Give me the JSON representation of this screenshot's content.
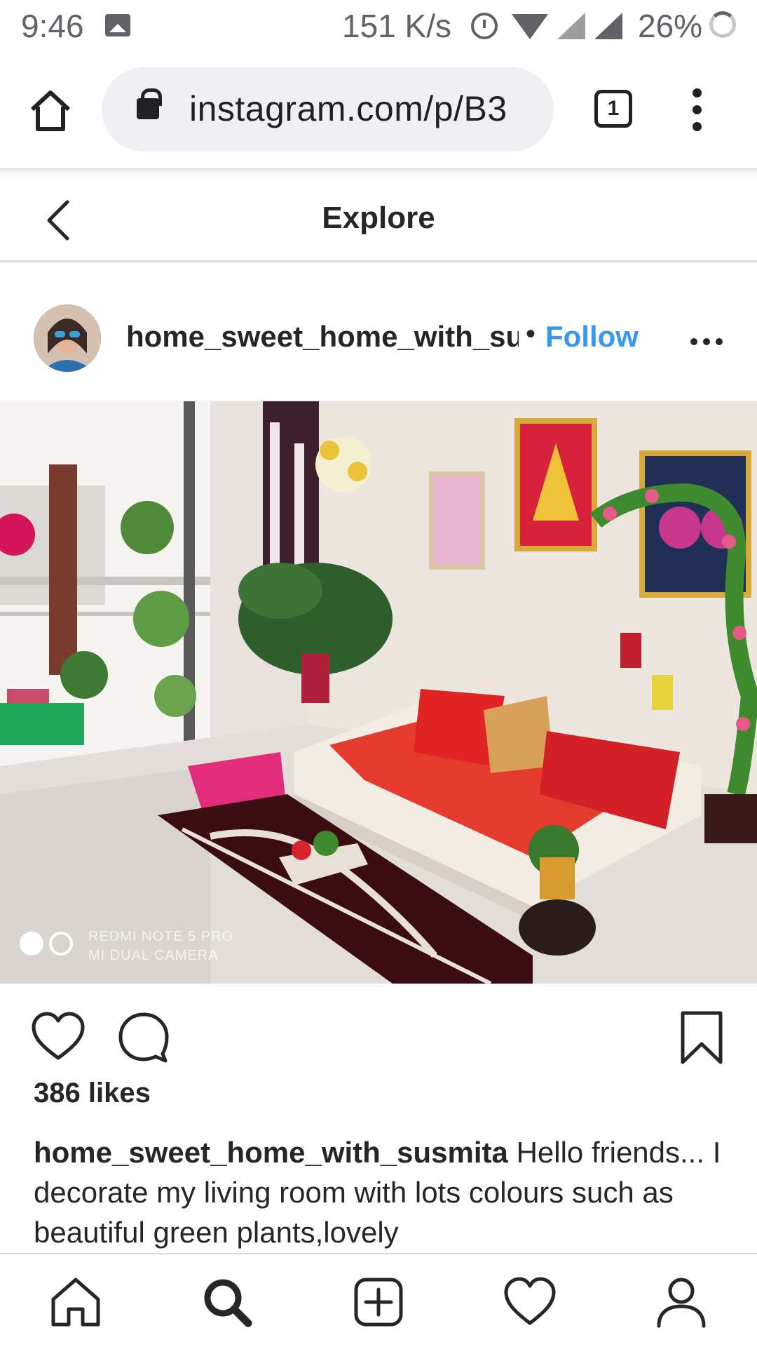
{
  "status_bar": {
    "time": "9:46",
    "network_speed": "151 K/s",
    "battery": "26%",
    "icons": [
      "image-icon",
      "alarm-icon",
      "wifi-icon",
      "signal-icon",
      "signal-icon",
      "battery-charging-icon"
    ]
  },
  "browser": {
    "url": "instagram.com/p/B3",
    "tab_count": "1",
    "icons": [
      "home-icon",
      "lock-icon",
      "tabs-icon",
      "overflow-menu-icon"
    ]
  },
  "header": {
    "title": "Explore",
    "back_icon": "chevron-left-icon"
  },
  "post": {
    "username": "home_sweet_home_with_susmita",
    "separator": "•",
    "follow_label": "Follow",
    "more_icon": "ellipsis-icon",
    "photo": {
      "description_icon": "photo-living-room",
      "watermark_line1": "REDMI NOTE 5 PRO",
      "watermark_line2": "MI DUAL CAMERA",
      "carousel_index": 1,
      "carousel_total": 2
    },
    "actions": [
      "heart-icon",
      "comment-icon",
      "bookmark-icon"
    ],
    "likes": "386 likes",
    "caption_user": "home_sweet_home_with_susmita",
    "caption_text": " Hello friends... I decorate my living room with lots colours such as beautiful green plants,lovely"
  },
  "bottom_nav": [
    "home-icon",
    "search-icon",
    "add-post-icon",
    "activity-heart-icon",
    "profile-icon"
  ],
  "colors": {
    "accent_blue": "#3897f0",
    "text": "#262626",
    "divider": "#dbdbdb"
  }
}
